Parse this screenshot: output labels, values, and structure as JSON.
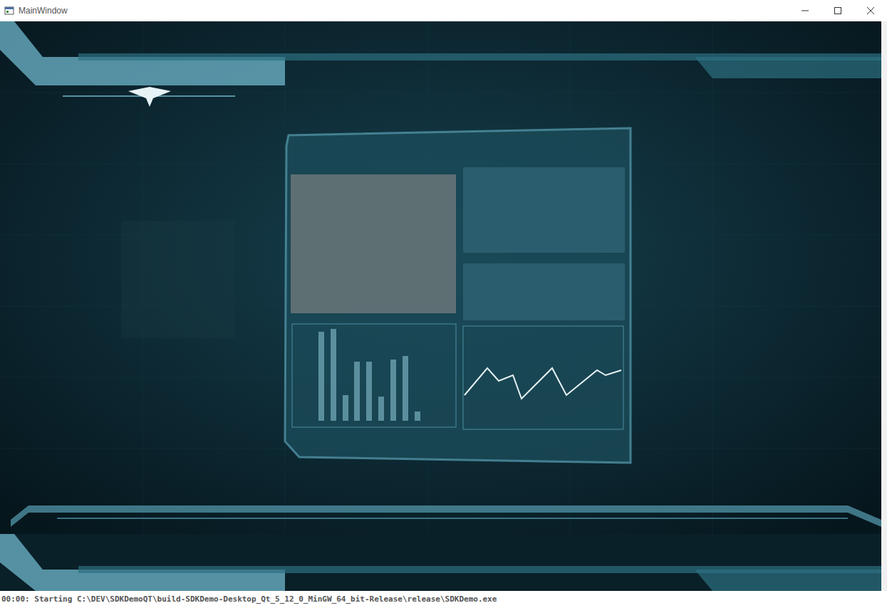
{
  "window": {
    "title": "MainWindow"
  },
  "console": {
    "line": "00:00: Starting C:\\DEV\\SDKDemoQT\\build-SDKDemo-Desktop_Qt_5_12_0_MinGW_64_bit-Release\\release\\SDKDemo.exe"
  }
}
